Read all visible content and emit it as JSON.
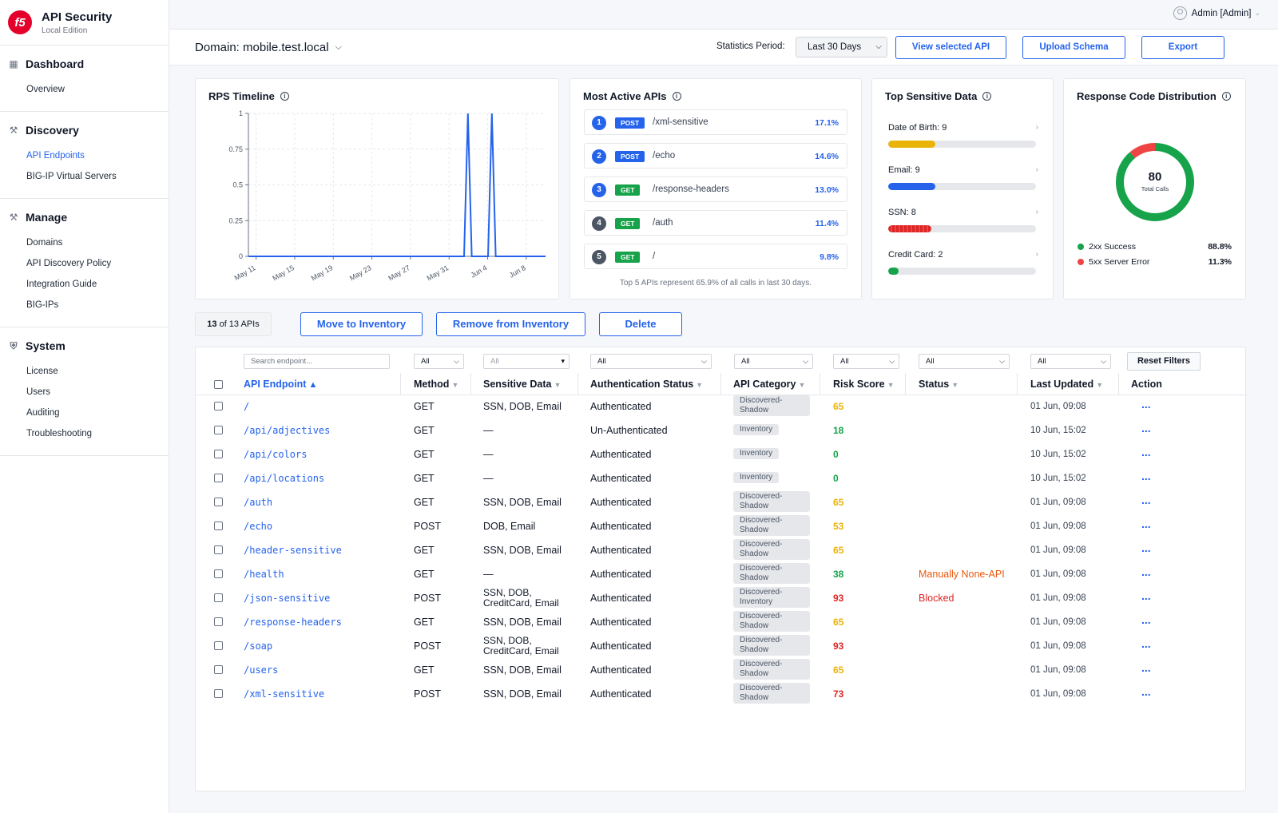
{
  "app": {
    "title": "API Security",
    "edition": "Local Edition",
    "logo_text": "f5"
  },
  "sidebar": {
    "sections": [
      {
        "title": "Dashboard",
        "icon": "grid-icon",
        "items": [
          {
            "label": "Overview",
            "active": false
          }
        ]
      },
      {
        "title": "Discovery",
        "icon": "wrench-icon",
        "items": [
          {
            "label": "API Endpoints",
            "active": true
          },
          {
            "label": "BIG-IP Virtual Servers",
            "active": false
          }
        ]
      },
      {
        "title": "Manage",
        "icon": "wrench-icon",
        "items": [
          {
            "label": "Domains"
          },
          {
            "label": "API Discovery Policy"
          },
          {
            "label": "Integration Guide"
          },
          {
            "label": "BIG-IPs"
          }
        ]
      },
      {
        "title": "System",
        "icon": "shield-icon",
        "items": [
          {
            "label": "License"
          },
          {
            "label": "Users"
          },
          {
            "label": "Auditing"
          },
          {
            "label": "Troubleshooting"
          }
        ]
      }
    ]
  },
  "topbar": {
    "user": "Admin [Admin]"
  },
  "domainbar": {
    "domain": "Domain: mobile.test.local",
    "stat_label": "Statistics Period:",
    "period": "Last 30 Days",
    "buttons": {
      "view": "View selected API",
      "upload": "Upload Schema",
      "export": "Export"
    }
  },
  "rps": {
    "title": "RPS Timeline",
    "chart_data": {
      "type": "line",
      "title": "RPS Timeline",
      "x_ticks": [
        "May 11",
        "May 15",
        "May 19",
        "May 23",
        "May 27",
        "May 31",
        "Jun 4",
        "Jun 8"
      ],
      "y_ticks": [
        "0",
        "0.25",
        "0.5",
        "0.75",
        "1"
      ],
      "ylim": [
        0,
        1
      ],
      "xlim": [
        0,
        31
      ],
      "grid": true,
      "series": [
        {
          "color": "#2563eb",
          "points": [
            [
              0,
              0
            ],
            [
              22.5,
              0
            ],
            [
              22.9,
              1
            ],
            [
              23.3,
              0
            ],
            [
              25.0,
              0
            ],
            [
              25.4,
              1
            ],
            [
              25.8,
              0
            ],
            [
              31,
              0
            ]
          ]
        }
      ]
    }
  },
  "most_active": {
    "title": "Most Active APIs",
    "items": [
      {
        "rank": "1",
        "method": "POST",
        "path": "/xml-sensitive",
        "pct": "17.1%"
      },
      {
        "rank": "2",
        "method": "POST",
        "path": "/echo",
        "pct": "14.6%"
      },
      {
        "rank": "3",
        "method": "GET",
        "path": "/response-headers",
        "pct": "13.0%"
      },
      {
        "rank": "4",
        "method": "GET",
        "path": "/auth",
        "pct": "11.4%"
      },
      {
        "rank": "5",
        "method": "GET",
        "path": "/",
        "pct": "9.8%"
      }
    ],
    "footer": "Top 5 APIs represent 65.9% of all calls in last 30 days."
  },
  "sensitive": {
    "title": "Top Sensitive Data",
    "items": [
      {
        "label": "Date of Birth: 9",
        "fraction": 0.32,
        "color": "#eab308"
      },
      {
        "label": "Email: 9",
        "fraction": 0.32,
        "color": "#2563eb"
      },
      {
        "label": "SSN: 8",
        "fraction": 0.29,
        "color": "#dc2626"
      },
      {
        "label": "Credit Card: 2",
        "fraction": 0.07,
        "color": "#16a34a"
      }
    ]
  },
  "response_codes": {
    "title": "Response Code Distribution",
    "total": "80",
    "total_label": "Total Calls",
    "legend": [
      {
        "label": "2xx Success",
        "value": "88.8%",
        "fraction": 0.888,
        "color": "#16a34a"
      },
      {
        "label": "5xx Server Error",
        "value": "11.3%",
        "fraction": 0.113,
        "color": "#ef4444"
      }
    ]
  },
  "actions": {
    "count_num": "13",
    "count_text": "of 13 APIs",
    "move": "Move to Inventory",
    "remove": "Remove from Inventory",
    "delete": "Delete"
  },
  "filters": {
    "search_placeholder": "Search endpoint...",
    "method": "All",
    "sensitive": "All",
    "auth": "All",
    "category": "All",
    "risk": "All",
    "status": "All",
    "updated": "All",
    "reset": "Reset Filters"
  },
  "table": {
    "headers": {
      "endpoint": "API Endpoint",
      "method": "Method",
      "sensitive": "Sensitive Data",
      "auth": "Authentication Status",
      "category": "API Category",
      "risk": "Risk Score",
      "status": "Status",
      "updated": "Last Updated",
      "action": "Action"
    },
    "action_label": "...",
    "rows": [
      {
        "endpoint": "/",
        "method": "GET",
        "sensitive": [
          "SSN, DOB, Email"
        ],
        "auth": "Authenticated",
        "category": [
          "Discovered-",
          "Shadow"
        ],
        "risk": "65",
        "risk_color": "#eab308",
        "status": "",
        "updated": "01 Jun, 09:08"
      },
      {
        "endpoint": "/api/adjectives",
        "method": "GET",
        "sensitive": [
          "—"
        ],
        "auth": "Un-Authenticated",
        "category": [
          "Inventory"
        ],
        "risk": "18",
        "risk_color": "#16a34a",
        "status": "",
        "updated": "10 Jun, 15:02"
      },
      {
        "endpoint": "/api/colors",
        "method": "GET",
        "sensitive": [
          "—"
        ],
        "auth": "Authenticated",
        "category": [
          "Inventory"
        ],
        "risk": "0",
        "risk_color": "#16a34a",
        "status": "",
        "updated": "10 Jun, 15:02"
      },
      {
        "endpoint": "/api/locations",
        "method": "GET",
        "sensitive": [
          "—"
        ],
        "auth": "Authenticated",
        "category": [
          "Inventory"
        ],
        "risk": "0",
        "risk_color": "#16a34a",
        "status": "",
        "updated": "10 Jun, 15:02"
      },
      {
        "endpoint": "/auth",
        "method": "GET",
        "sensitive": [
          "SSN, DOB, Email"
        ],
        "auth": "Authenticated",
        "category": [
          "Discovered-",
          "Shadow"
        ],
        "risk": "65",
        "risk_color": "#eab308",
        "status": "",
        "updated": "01 Jun, 09:08"
      },
      {
        "endpoint": "/echo",
        "method": "POST",
        "sensitive": [
          "DOB, Email"
        ],
        "auth": "Authenticated",
        "category": [
          "Discovered-",
          "Shadow"
        ],
        "risk": "53",
        "risk_color": "#eab308",
        "status": "",
        "updated": "01 Jun, 09:08"
      },
      {
        "endpoint": "/header-sensitive",
        "method": "GET",
        "sensitive": [
          "SSN, DOB, Email"
        ],
        "auth": "Authenticated",
        "category": [
          "Discovered-",
          "Shadow"
        ],
        "risk": "65",
        "risk_color": "#eab308",
        "status": "",
        "updated": "01 Jun, 09:08"
      },
      {
        "endpoint": "/health",
        "method": "GET",
        "sensitive": [
          "—"
        ],
        "auth": "Authenticated",
        "category": [
          "Discovered-",
          "Shadow"
        ],
        "risk": "38",
        "risk_color": "#16a34a",
        "status": "Manually None-API",
        "status_color": "#ea580c",
        "updated": "01 Jun, 09:08"
      },
      {
        "endpoint": "/json-sensitive",
        "method": "POST",
        "sensitive": [
          "SSN, DOB,",
          "CreditCard, Email"
        ],
        "auth": "Authenticated",
        "category": [
          "Discovered-",
          "Inventory"
        ],
        "risk": "93",
        "risk_color": "#dc2626",
        "status": "Blocked",
        "status_color": "#dc2626",
        "updated": "01 Jun, 09:08"
      },
      {
        "endpoint": "/response-headers",
        "method": "GET",
        "sensitive": [
          "SSN, DOB, Email"
        ],
        "auth": "Authenticated",
        "category": [
          "Discovered-",
          "Shadow"
        ],
        "risk": "65",
        "risk_color": "#eab308",
        "status": "",
        "updated": "01 Jun, 09:08"
      },
      {
        "endpoint": "/soap",
        "method": "POST",
        "sensitive": [
          "SSN, DOB,",
          "CreditCard, Email"
        ],
        "auth": "Authenticated",
        "category": [
          "Discovered-",
          "Shadow"
        ],
        "risk": "93",
        "risk_color": "#dc2626",
        "status": "",
        "updated": "01 Jun, 09:08"
      },
      {
        "endpoint": "/users",
        "method": "GET",
        "sensitive": [
          "SSN, DOB, Email"
        ],
        "auth": "Authenticated",
        "category": [
          "Discovered-",
          "Shadow"
        ],
        "risk": "65",
        "risk_color": "#eab308",
        "status": "",
        "updated": "01 Jun, 09:08"
      },
      {
        "endpoint": "/xml-sensitive",
        "method": "POST",
        "sensitive": [
          "SSN, DOB, Email"
        ],
        "auth": "Authenticated",
        "category": [
          "Discovered-",
          "Shadow"
        ],
        "risk": "73",
        "risk_color": "#dc2626",
        "status": "",
        "updated": "01 Jun, 09:08"
      }
    ]
  }
}
